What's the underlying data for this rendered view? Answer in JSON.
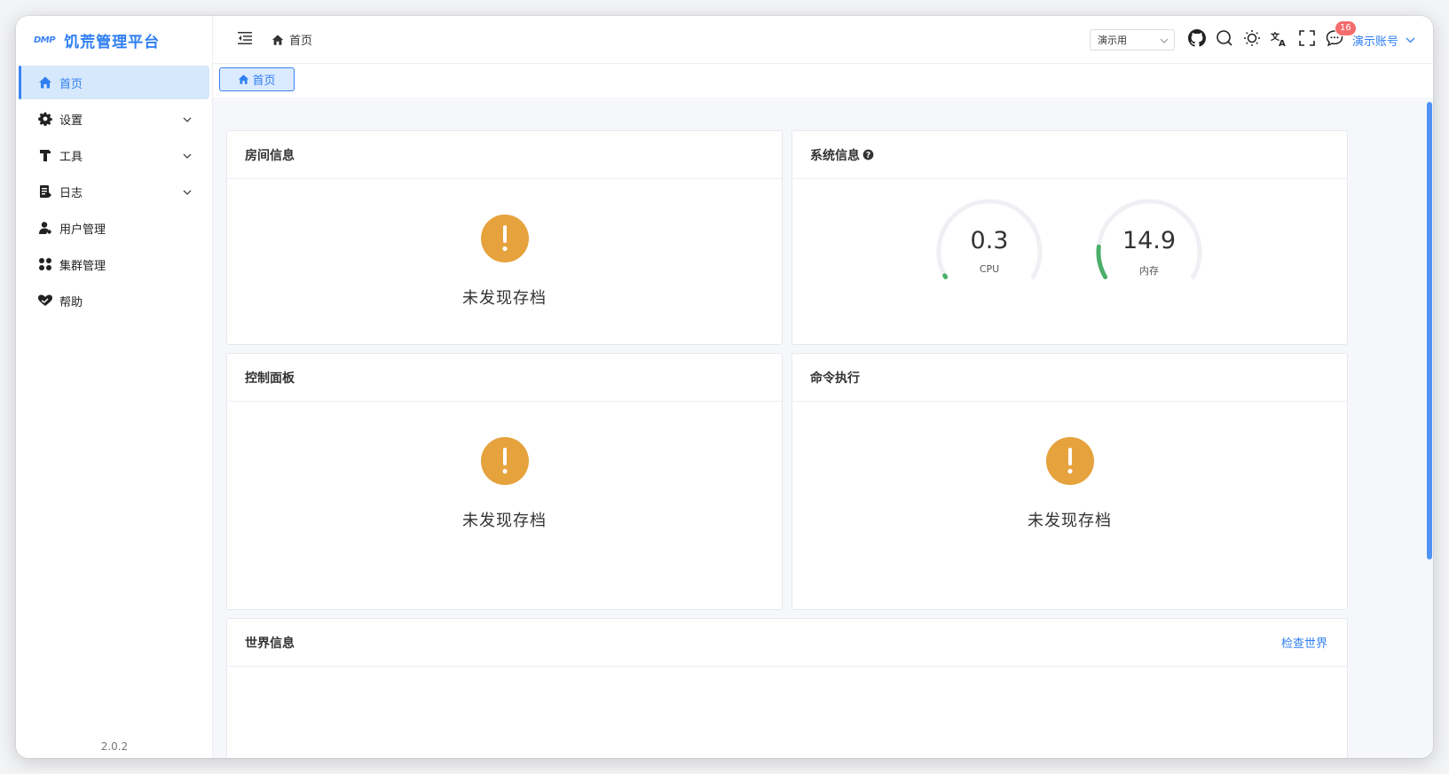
{
  "sidebar": {
    "logo_mark": "DMP",
    "title": "饥荒管理平台",
    "items": [
      {
        "label": "首页",
        "icon": "home-icon"
      },
      {
        "label": "设置",
        "icon": "gear-icon"
      },
      {
        "label": "工具",
        "icon": "hammer-icon"
      },
      {
        "label": "日志",
        "icon": "log-icon"
      },
      {
        "label": "用户管理",
        "icon": "user-icon"
      },
      {
        "label": "集群管理",
        "icon": "grid-icon"
      },
      {
        "label": "帮助",
        "icon": "heart-hand-icon"
      }
    ],
    "version": "2.0.2"
  },
  "header": {
    "breadcrumb": "首页",
    "select_value": "演示用",
    "badge_count": "16",
    "account": "演示账号"
  },
  "tabs": [
    {
      "label": "首页"
    }
  ],
  "cards": {
    "room": {
      "title": "房间信息",
      "empty": "未发现存档"
    },
    "system": {
      "title": "系统信息",
      "cpu": {
        "value": "0.3",
        "label": "CPU",
        "fraction": 0.003
      },
      "mem": {
        "value": "14.9",
        "label": "内存",
        "fraction": 0.149
      }
    },
    "control": {
      "title": "控制面板",
      "empty": "未发现存档"
    },
    "command": {
      "title": "命令执行",
      "empty": "未发现存档"
    },
    "world": {
      "title": "世界信息",
      "link": "检查世界"
    }
  },
  "colors": {
    "accent": "#2f7ff2",
    "warning": "#e6a23c",
    "gauge_fill": "#4caf6a",
    "gauge_track": "#eef0f3",
    "badge": "#f56c6c"
  }
}
